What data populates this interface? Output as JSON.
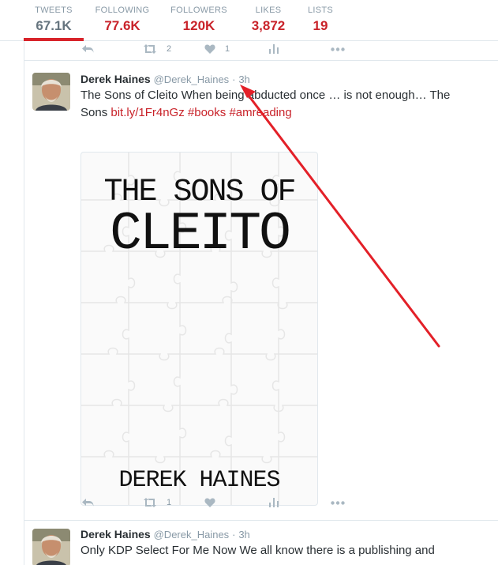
{
  "profile_nav": {
    "items": [
      {
        "label": "TWEETS",
        "value": "67.1K"
      },
      {
        "label": "FOLLOWING",
        "value": "77.6K"
      },
      {
        "label": "FOLLOWERS",
        "value": "120K"
      },
      {
        "label": "LIKES",
        "value": "3,872"
      },
      {
        "label": "LISTS",
        "value": "19"
      }
    ],
    "active": "TWEETS"
  },
  "previous_tweet_actions": {
    "retweets": "2",
    "likes": "1"
  },
  "tweets": [
    {
      "fullname": "Derek Haines",
      "screen_name": "@Derek_Haines",
      "separator": "·",
      "time": "3h",
      "text_line1": "The Sons of Cleito When being abducted once … is not enough… The",
      "text_line2_prefix": "Sons ",
      "link_url": "bit.ly/1Fr4nGz",
      "link_hashtag1": "#books",
      "link_hashtag2": "#amreading",
      "image": {
        "title_line1": "THE SONS OF",
        "title_line2": "CLEITO",
        "author": "DEREK HAINES"
      },
      "retweets": "1"
    },
    {
      "fullname": "Derek Haines",
      "screen_name": "@Derek_Haines",
      "separator": "·",
      "time": "3h",
      "text_line1": "Only KDP Select For Me Now We all know there is a publishing and"
    }
  ],
  "colors": {
    "accent": "#c9232a",
    "active_underline": "#d8232a",
    "muted": "#8899a6",
    "icon": "#aab8c2",
    "annotation_arrow": "#e32028"
  },
  "icons": [
    "reply-icon",
    "retweet-icon",
    "like-icon",
    "analytics-icon",
    "more-icon"
  ]
}
